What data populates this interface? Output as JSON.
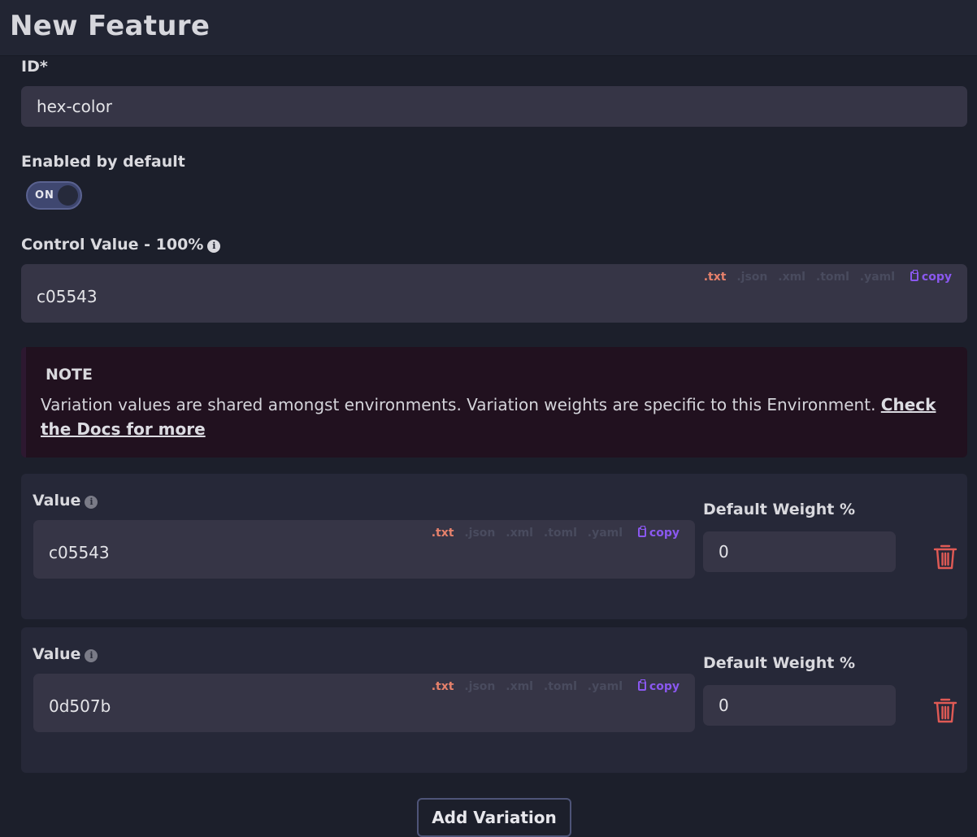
{
  "header": {
    "title": "New Feature"
  },
  "id_field": {
    "label": "ID*",
    "value": "hex-color"
  },
  "enabled": {
    "label": "Enabled by default",
    "toggle_text": "ON",
    "state": true
  },
  "control": {
    "label": "Control Value - 100%",
    "value": "c05543",
    "formats": [
      ".txt",
      ".json",
      ".xml",
      ".toml",
      ".yaml"
    ],
    "active_format": ".txt",
    "copy_label": "copy"
  },
  "note": {
    "title": "NOTE",
    "text": "Variation values are shared amongst environments. Variation weights are specific to this Environment. ",
    "link": "Check the Docs for more"
  },
  "variations": [
    {
      "value_label": "Value",
      "value": "c05543",
      "weight_label": "Default Weight %",
      "weight": "0",
      "formats": [
        ".txt",
        ".json",
        ".xml",
        ".toml",
        ".yaml"
      ],
      "copy_label": "copy"
    },
    {
      "value_label": "Value",
      "value": "0d507b",
      "weight_label": "Default Weight %",
      "weight": "0",
      "formats": [
        ".txt",
        ".json",
        ".xml",
        ".toml",
        ".yaml"
      ],
      "copy_label": "copy"
    }
  ],
  "add_variation_label": "Add Variation",
  "colors": {
    "accent": "#8a58ef",
    "active_format": "#e6816b",
    "delete": "#e05a55",
    "background": "#1c1f2b"
  },
  "icons": {
    "info": "info-icon",
    "copy": "clipboard-icon",
    "delete": "trash-icon"
  }
}
